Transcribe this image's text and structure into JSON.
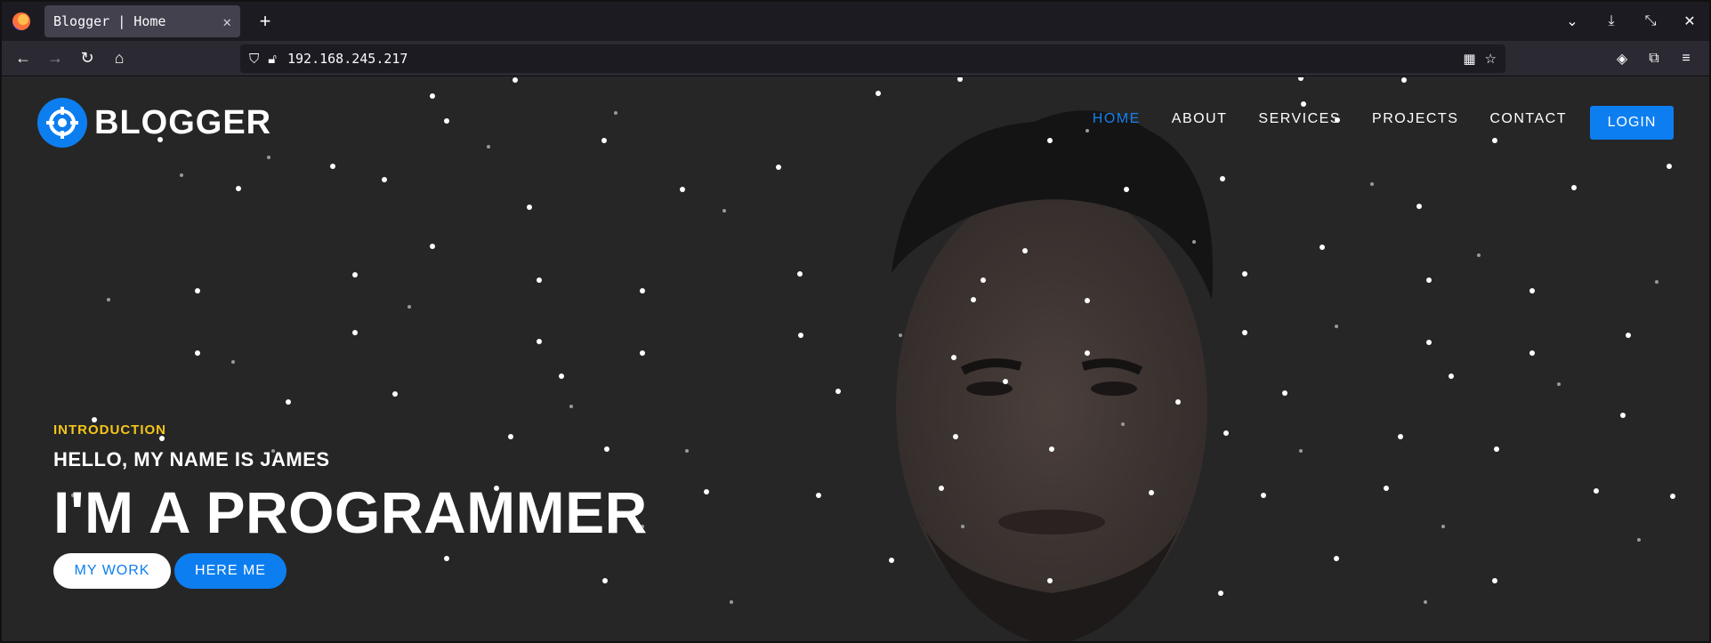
{
  "browser": {
    "tab_title": "Blogger | Home",
    "url": "192.168.245.217"
  },
  "site": {
    "brand": "BLOGGER",
    "nav": [
      {
        "label": "HOME",
        "active": true
      },
      {
        "label": "ABOUT",
        "active": false
      },
      {
        "label": "SERVICES",
        "active": false
      },
      {
        "label": "PROJECTS",
        "active": false
      },
      {
        "label": "CONTACT",
        "active": false
      }
    ],
    "login_label": "LOGIN"
  },
  "hero": {
    "kicker": "INTRODUCTION",
    "greeting": "HELLO, MY NAME IS JAMES",
    "headline": "I'M A PROGRAMMER",
    "primary_button": "MY WORK",
    "secondary_button": "HERE ME"
  },
  "colors": {
    "accent": "#0d7ef0",
    "kicker": "#f5c518",
    "background": "#262626"
  }
}
